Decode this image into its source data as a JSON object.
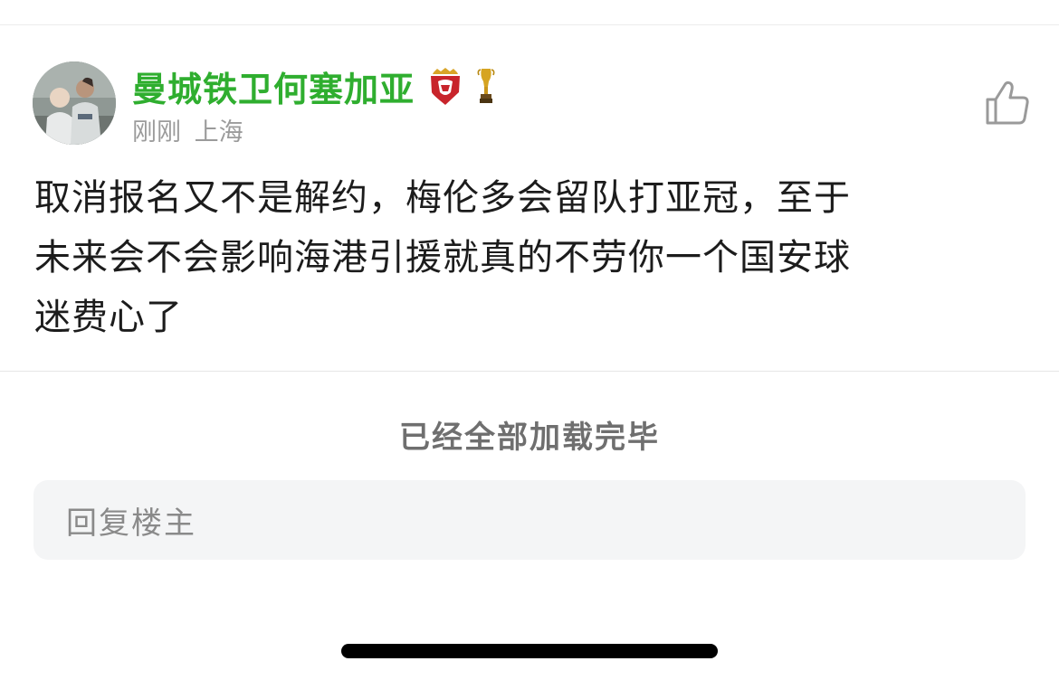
{
  "post": {
    "username": "曼城铁卫何塞加亚",
    "time": "刚刚",
    "location": "上海",
    "content_lines": [
      "取消报名又不是解约，梅伦多会留队打亚冠，至于",
      "未来会不会影响海港引援就真的不劳你一个国安球",
      "迷费心了"
    ],
    "badges": [
      "club-badge-icon",
      "trophy-icon"
    ],
    "like_icon": "thumbs-up-icon"
  },
  "footer": {
    "loaded_all": "已经全部加载完毕"
  },
  "reply": {
    "placeholder": "回复楼主"
  },
  "colors": {
    "username": "#2fae2f",
    "meta": "#9b9b9b",
    "reply_bg": "#f4f5f6"
  }
}
